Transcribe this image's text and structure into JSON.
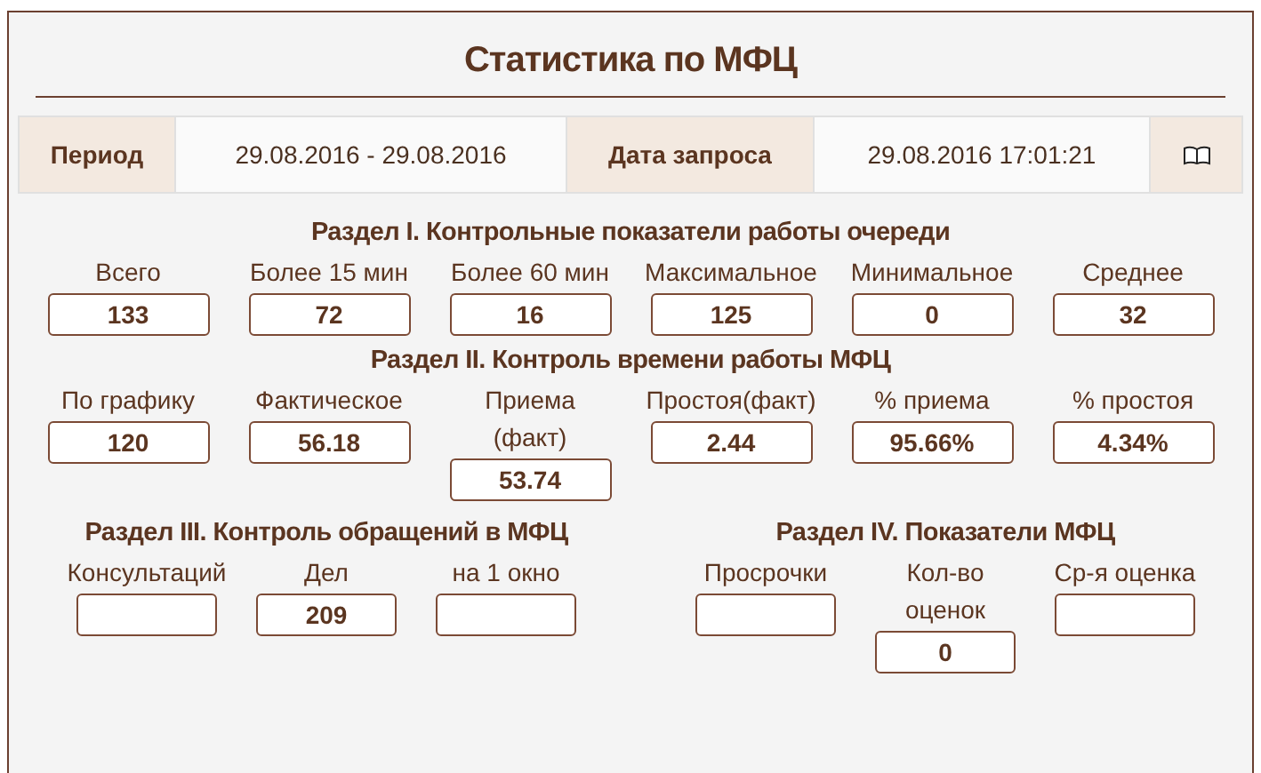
{
  "title": "Статистика по МФЦ",
  "info_bar": {
    "period_label": "Период",
    "period_value": "29.08.2016 - 29.08.2016",
    "request_date_label": "Дата запроса",
    "request_date_value": "29.08.2016 17:01:21"
  },
  "sections": [
    {
      "title": "Раздел I. Контрольные показатели работы очереди",
      "fields": [
        {
          "label": "Всего",
          "value": "133"
        },
        {
          "label": "Более 15 мин",
          "value": "72"
        },
        {
          "label": "Более 60 мин",
          "value": "16"
        },
        {
          "label": "Максимальное",
          "value": "125"
        },
        {
          "label": "Минимальное",
          "value": "0"
        },
        {
          "label": "Среднее",
          "value": "32"
        }
      ]
    },
    {
      "title": "Раздел II. Контроль времени работы МФЦ",
      "fields": [
        {
          "label": "По графику",
          "value": "120"
        },
        {
          "label": "Фактическое",
          "value": "56.18"
        },
        {
          "label": "Приема\n(факт)",
          "value": "53.74"
        },
        {
          "label": "Простоя(факт)",
          "value": "2.44"
        },
        {
          "label": "% приема",
          "value": "95.66%"
        },
        {
          "label": "% простоя",
          "value": "4.34%"
        }
      ]
    }
  ],
  "bottom_sections": [
    {
      "title": "Раздел III. Контроль обращений в МФЦ",
      "fields": [
        {
          "label": "Консультаций"
        },
        {
          "label": "Дел",
          "value": "209"
        },
        {
          "label": "на 1 окно"
        }
      ]
    },
    {
      "title": "Раздел IV. Показатели МФЦ",
      "fields": [
        {
          "label": "Просрочки"
        },
        {
          "label": "Кол-во\nоценок",
          "value": "0"
        },
        {
          "label": "Ср-я оценка"
        }
      ]
    }
  ]
}
